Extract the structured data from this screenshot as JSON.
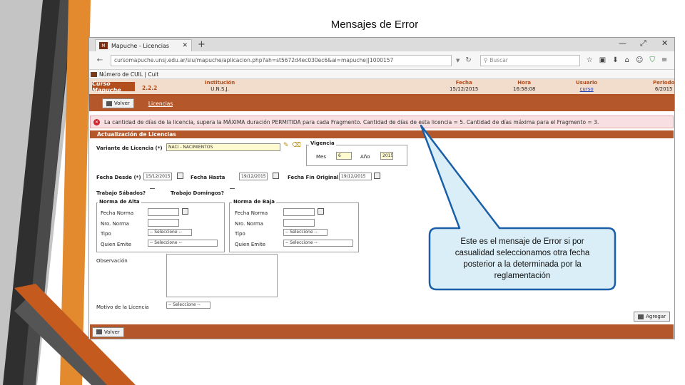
{
  "slide": {
    "title": "Mensajes de Error"
  },
  "colors": {
    "accent": "#b4572b",
    "error_bg": "#f7dfe2",
    "callout_fill": "#daeef7",
    "callout_border": "#1a5fa8"
  },
  "browser": {
    "tab_label": "Mapuche - Licencias",
    "favicon_text": "M",
    "url": "cursomapuche.unsj.edu.ar/siu/mapuche/aplicacion.php?ah=st5672d4ec030ec6&ai=mapuche||1000157",
    "search_placeholder": "Buscar",
    "bookmark": "Número de CUIL | Cuit",
    "icons": [
      "back-icon",
      "forward-icon",
      "reload-icon",
      "star-icon",
      "reading-list-icon",
      "download-icon",
      "home-icon",
      "smiley-icon",
      "shield-icon",
      "menu-icon"
    ]
  },
  "header": {
    "logo": "Curso Mapuche",
    "version": "2.2.2",
    "institucion_label": "Institución",
    "institucion_value": "U.N.S.J.",
    "fecha_label": "Fecha",
    "fecha_value": "15/12/2015",
    "hora_label": "Hora",
    "hora_value": "16:58:08",
    "usuario_label": "Usuario",
    "usuario_value": "curso",
    "periodo_label": "Periodo",
    "periodo_value": "6/2015"
  },
  "toolbar": {
    "volver_label": "Volver",
    "link_label": "Licencias"
  },
  "error_message": "La cantidad de días de la licencia, supera la MÁXIMA duración PERMITIDA para cada Fragmento. Cantidad de días de esta licencia = 5. Cantidad de días máxima para el Fragmento = 3.",
  "form": {
    "section_title": "Actualización de Licencias",
    "variante_label": "Variante de Licencia (*)",
    "variante_value": "NACI - NACIMIENTOS",
    "vigencia_legend": "Vigencia",
    "mes_label": "Mes",
    "mes_value": "6",
    "anio_label": "Año",
    "anio_value": "2015",
    "fecha_desde_label": "Fecha Desde (*)",
    "fecha_desde_value": "15/12/2015",
    "fecha_hasta_label": "Fecha Hasta",
    "fecha_hasta_value": "19/12/2015",
    "fecha_fin_label": "Fecha Fin Original",
    "fecha_fin_value": "19/12/2015",
    "trabajo_sabados_label": "Trabajo Sábados?",
    "trabajo_domingos_label": "Trabajo Domingos?",
    "norma_alta": {
      "legend": "Norma de Alta",
      "fecha_norma": "Fecha Norma",
      "nro_norma": "Nro. Norma",
      "tipo": "Tipo",
      "quien_emite": "Quien Emite",
      "select_placeholder": "-- Seleccione --"
    },
    "norma_baja": {
      "legend": "Norma de Baja",
      "fecha_norma": "Fecha Norma",
      "nro_norma": "Nro. Norma",
      "tipo": "Tipo",
      "quien_emite": "Quien Emite",
      "select_placeholder": "-- Seleccione --"
    },
    "observacion_label": "Observación",
    "motivo_label": "Motivo de la Licencia",
    "motivo_placeholder": "-- Seleccione --",
    "agregar_label": "Agregar",
    "volver_label": "Volver"
  },
  "callout": {
    "text": "Este es el mensaje de Error si por casualidad seleccionamos otra fecha posterior a la determinada por la reglamentación"
  }
}
